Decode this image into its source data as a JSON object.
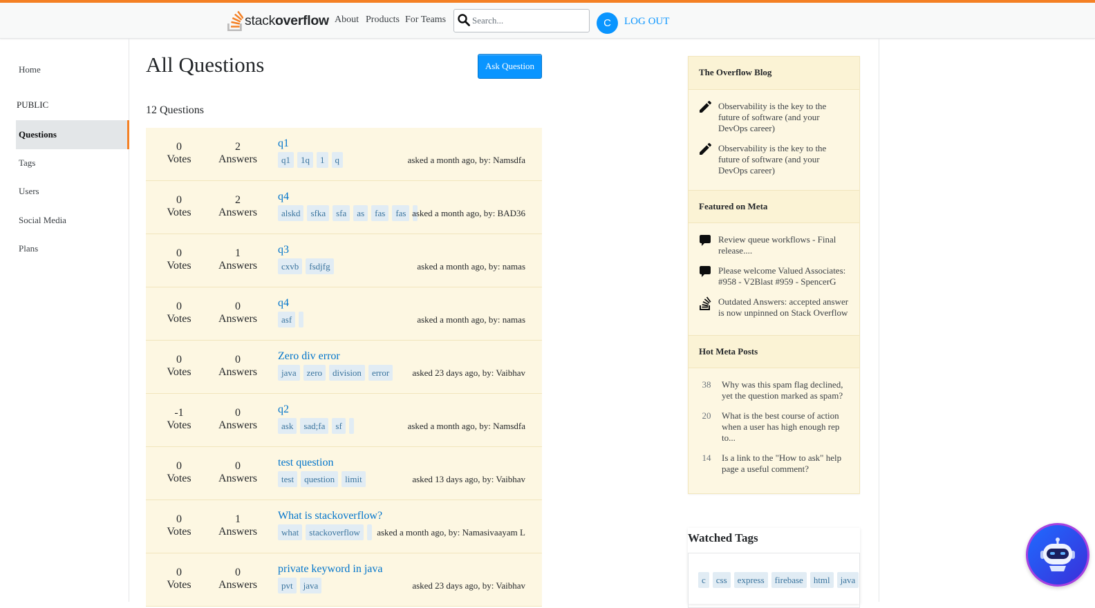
{
  "header": {
    "logo_text_regular": "stack",
    "logo_text_bold": "overflow",
    "nav": [
      "About",
      "Products",
      "For Teams"
    ],
    "search_placeholder": "Search...",
    "avatar_letter": "C",
    "logout_label": "LOG OUT"
  },
  "sidebar": {
    "home": "Home",
    "section": "PUBLIC",
    "items": [
      "Questions",
      "Tags",
      "Users",
      "Social Media",
      "Plans"
    ],
    "active": "Questions"
  },
  "main": {
    "title": "All Questions",
    "ask_button": "Ask Question",
    "count_text": "12 Questions",
    "votes_label": "Votes",
    "answers_label": "Answers",
    "questions": [
      {
        "votes": "0",
        "answers": "2",
        "title": "q1",
        "tags": [
          "q1",
          "1q",
          "1",
          "q"
        ],
        "asked": "asked a month ago, by: Namsdfa"
      },
      {
        "votes": "0",
        "answers": "2",
        "title": "q4",
        "tags": [
          "alskd",
          "sfka",
          "sfa",
          "as",
          "fas",
          "fas",
          ""
        ],
        "asked": "asked a month ago, by: BAD36"
      },
      {
        "votes": "0",
        "answers": "1",
        "title": "q3",
        "tags": [
          "cxvb",
          "fsdjfg"
        ],
        "asked": "asked a month ago, by: namas"
      },
      {
        "votes": "0",
        "answers": "0",
        "title": "q4",
        "tags": [
          "asf",
          ""
        ],
        "asked": "asked a month ago, by: namas"
      },
      {
        "votes": "0",
        "answers": "0",
        "title": "Zero div error",
        "tags": [
          "java",
          "zero",
          "division",
          "error"
        ],
        "asked": "asked 23 days ago, by: Vaibhav"
      },
      {
        "votes": "-1",
        "answers": "0",
        "title": "q2",
        "tags": [
          "ask",
          "sad;fa",
          "sf",
          ""
        ],
        "asked": "asked a month ago, by: Namsdfa"
      },
      {
        "votes": "0",
        "answers": "0",
        "title": "test question",
        "tags": [
          "test",
          "question",
          "limit"
        ],
        "asked": "asked 13 days ago, by: Vaibhav"
      },
      {
        "votes": "0",
        "answers": "1",
        "title": "What is stackoverflow?",
        "tags": [
          "what",
          "stackoverflow",
          ""
        ],
        "asked": "asked a month ago, by: Namasivaayam L"
      },
      {
        "votes": "0",
        "answers": "0",
        "title": "private keyword in java",
        "tags": [
          "pvt",
          "java"
        ],
        "asked": "asked 23 days ago, by: Vaibhav"
      }
    ]
  },
  "right_sidebar": {
    "blog_title": "The Overflow Blog",
    "blog_items": [
      "Observability is the key to the future of software (and your DevOps career)",
      "Observability is the key to the future of software (and your DevOps career)"
    ],
    "meta_title": "Featured on Meta",
    "meta_items": [
      {
        "icon": "comment-icon",
        "text": "Review queue workflows - Final release...."
      },
      {
        "icon": "comment-icon",
        "text": "Please welcome Valued Associates: #958 - V2Blast #959 - SpencerG"
      },
      {
        "icon": "stack-overflow-icon",
        "text": "Outdated Answers: accepted answer is now unpinned on Stack Overflow"
      }
    ],
    "hot_title": "Hot Meta Posts",
    "hot_items": [
      {
        "count": "38",
        "text": "Why was this spam flag declined, yet the question marked as spam?"
      },
      {
        "count": "20",
        "text": "What is the best course of action when a user has high enough rep to..."
      },
      {
        "count": "14",
        "text": "Is a link to the \"How to ask\" help page a useful comment?"
      }
    ],
    "watched_title": "Watched Tags",
    "watched_tags": [
      "c",
      "css",
      "express",
      "firebase",
      "html",
      "java"
    ]
  },
  "colors": {
    "accent_orange": "#f48024",
    "link_blue": "#0074cc",
    "button_blue": "#0a95ff",
    "card_bg": "#fdf7e2",
    "tag_bg": "#e1ecf4"
  }
}
